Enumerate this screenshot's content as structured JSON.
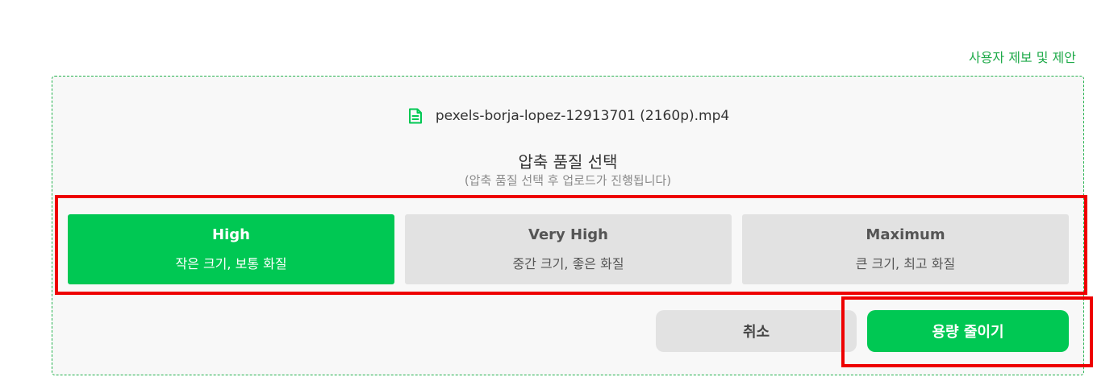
{
  "header": {
    "feedback_link": "사용자 제보 및 제안"
  },
  "file": {
    "icon": "document-icon",
    "name": "pexels-borja-lopez-12913701 (2160p).mp4"
  },
  "quality": {
    "title": "압축 품질 선택",
    "subtitle": "(압축 품질 선택 후 업로드가 진행됩니다)",
    "selected": "High",
    "options": [
      {
        "name": "High",
        "desc": "작은 크기, 보통 화질"
      },
      {
        "name": "Very High",
        "desc": "중간 크기, 좋은 화질"
      },
      {
        "name": "Maximum",
        "desc": "큰 크기, 최고 화질"
      }
    ]
  },
  "actions": {
    "cancel_label": "취소",
    "reduce_label": "용량 줄이기"
  },
  "colors": {
    "accent": "#00c853",
    "dashed_border": "#23b14d",
    "highlight": "#ee0000",
    "option_bg": "#e2e2e2"
  }
}
